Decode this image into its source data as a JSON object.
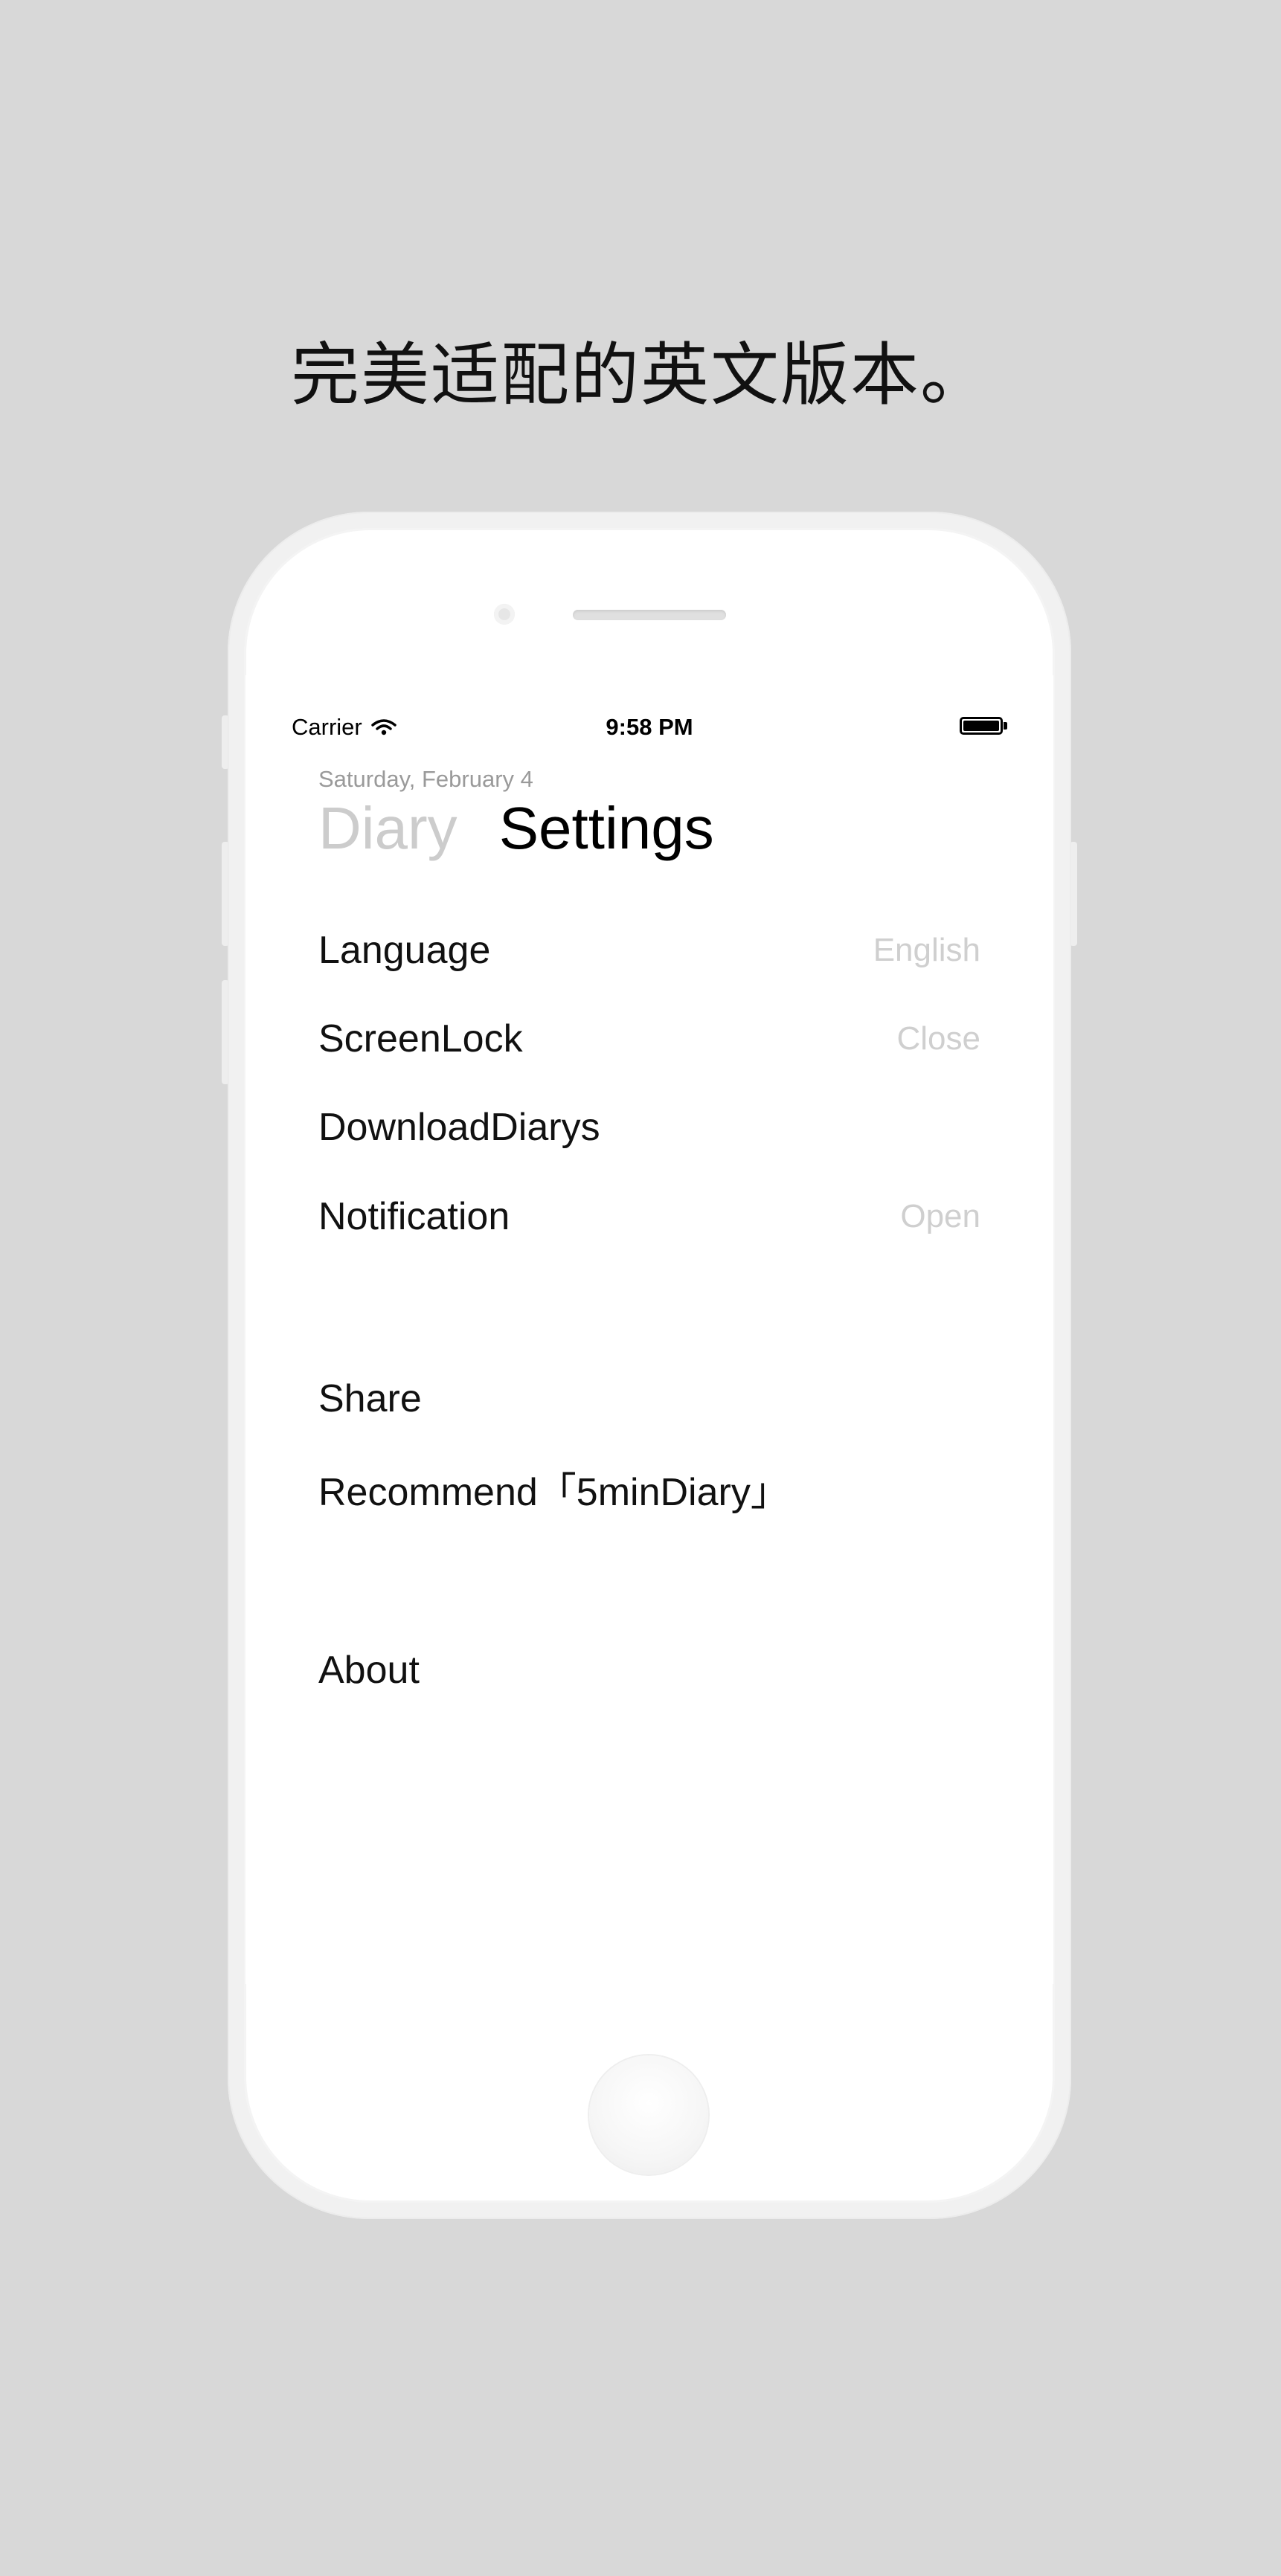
{
  "headline": "完美适配的英文版本。",
  "status_bar": {
    "carrier": "Carrier",
    "time": "9:58 PM"
  },
  "header": {
    "date": "Saturday, February 4",
    "tabs": [
      {
        "label": "Diary",
        "active": false
      },
      {
        "label": "Settings",
        "active": true
      }
    ]
  },
  "settings": {
    "language": {
      "label": "Language",
      "value": "English"
    },
    "screenlock": {
      "label": "ScreenLock",
      "value": "Close"
    },
    "download": {
      "label": "DownloadDiarys"
    },
    "notification": {
      "label": "Notification",
      "value": "Open"
    },
    "share": {
      "label": "Share"
    },
    "recommend": {
      "label": "Recommend「5minDiary」"
    },
    "about": {
      "label": "About"
    }
  },
  "colors": {
    "background": "#d8d8d8",
    "active_tab": "#000000",
    "inactive_tab": "#cccccc",
    "value_text": "#cfcfcf"
  }
}
